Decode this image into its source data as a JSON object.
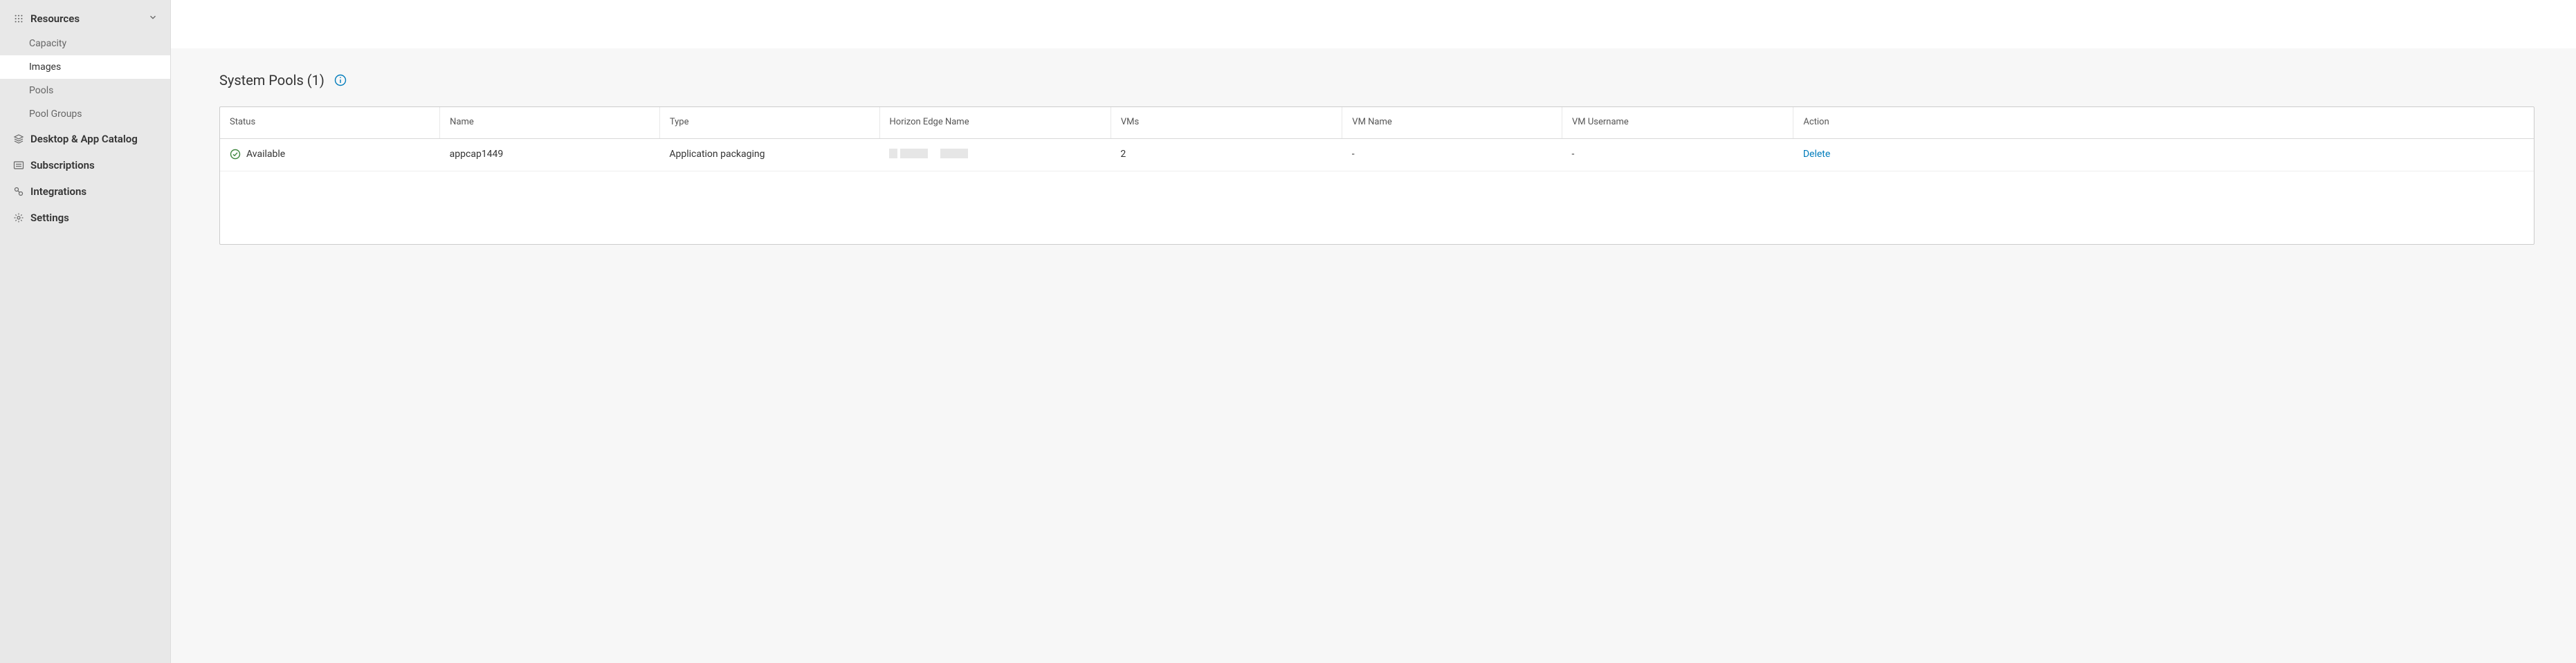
{
  "sidebar": {
    "resources": {
      "label": "Resources",
      "items": [
        {
          "label": "Capacity"
        },
        {
          "label": "Images"
        },
        {
          "label": "Pools"
        },
        {
          "label": "Pool Groups"
        }
      ]
    },
    "desktop_app_catalog": {
      "label": "Desktop & App Catalog"
    },
    "subscriptions": {
      "label": "Subscriptions"
    },
    "integrations": {
      "label": "Integrations"
    },
    "settings": {
      "label": "Settings"
    }
  },
  "panel": {
    "title": "System Pools (1)"
  },
  "table": {
    "headers": {
      "status": "Status",
      "name": "Name",
      "type": "Type",
      "edge": "Horizon Edge Name",
      "vms": "VMs",
      "vmname": "VM Name",
      "vmuser": "VM Username",
      "action": "Action"
    },
    "row0": {
      "status": "Available",
      "name": "appcap1449",
      "type": "Application packaging",
      "vms": "2",
      "vmname": "-",
      "vmuser": "-",
      "action": "Delete"
    }
  }
}
